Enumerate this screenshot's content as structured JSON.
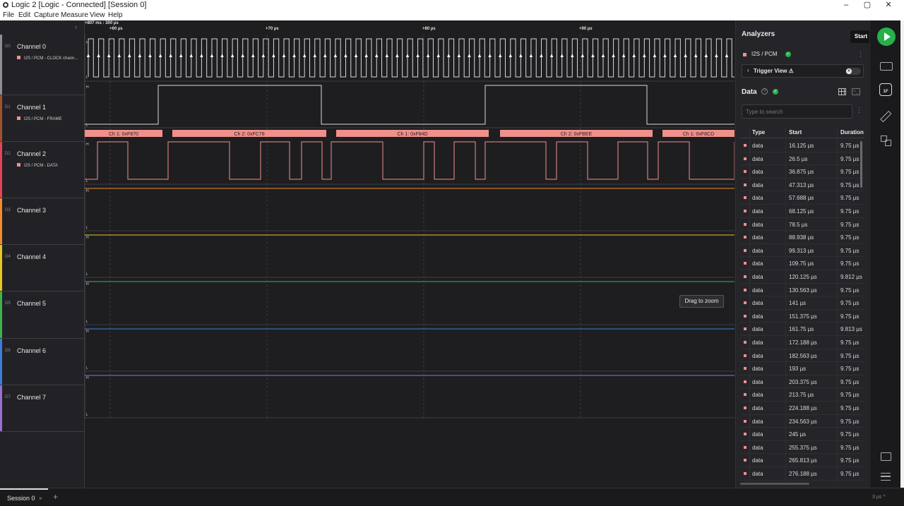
{
  "window": {
    "title": "Logic 2 [Logic - Connected] [Session 0]",
    "minimize": "–",
    "maximize": "▢",
    "close": "✕"
  },
  "menu": [
    "File",
    "Edit",
    "Capture",
    "Measure",
    "View",
    "Help"
  ],
  "ruler": {
    "cursor_label": "+807 ms : 300 µs",
    "ticks": [
      "+60 µs",
      "+70 µs",
      "+80 µs",
      "+90 µs"
    ]
  },
  "channels": [
    {
      "num": "D0",
      "name": "Channel 0",
      "sub": "I2S / PCM - CLOCK chann...",
      "color": "#8e8e93"
    },
    {
      "num": "D1",
      "name": "Channel 1",
      "sub": "I2S / PCM - FRAME",
      "color": "#a0522d"
    },
    {
      "num": "D2",
      "name": "Channel 2",
      "sub": "I2S / PCM - DATA",
      "color": "#e0455a"
    },
    {
      "num": "D3",
      "name": "Channel 3",
      "sub": "",
      "color": "#f08c2a"
    },
    {
      "num": "D4",
      "name": "Channel 4",
      "sub": "",
      "color": "#e9c723"
    },
    {
      "num": "D5",
      "name": "Channel 5",
      "sub": "",
      "color": "#3cb44b"
    },
    {
      "num": "D6",
      "name": "Channel 6",
      "sub": "",
      "color": "#3d7fd6"
    },
    {
      "num": "D7",
      "name": "Channel 7",
      "sub": "",
      "color": "#9b6fd6"
    }
  ],
  "level_labels": {
    "high": "H",
    "low": "L"
  },
  "decoded_frames": [
    "Ch 1: 0xF870",
    "Ch 2: 0xFC76",
    "Ch 1: 0xF84D",
    "Ch 2: 0xFBEE",
    "Ch 1: 0xF8CD"
  ],
  "tooltip": "Drag to zoom",
  "panel": {
    "analyzers_title": "Analyzers",
    "start_label": "Start",
    "analyzer_name": "I2S / PCM",
    "trigger_view": "Trigger View ⚠",
    "data_title": "Data",
    "search_placeholder": "Type to search",
    "columns": [
      "Type",
      "Start",
      "Duration"
    ],
    "rows": [
      [
        "data",
        "16.125 µs",
        "9.75 µs"
      ],
      [
        "data",
        "26.5 µs",
        "9.75 µs"
      ],
      [
        "data",
        "36.875 µs",
        "9.75 µs"
      ],
      [
        "data",
        "47.313 µs",
        "9.75 µs"
      ],
      [
        "data",
        "57.688 µs",
        "9.75 µs"
      ],
      [
        "data",
        "68.125 µs",
        "9.75 µs"
      ],
      [
        "data",
        "78.5 µs",
        "9.75 µs"
      ],
      [
        "data",
        "88.938 µs",
        "9.75 µs"
      ],
      [
        "data",
        "99.313 µs",
        "9.75 µs"
      ],
      [
        "data",
        "109.75 µs",
        "9.75 µs"
      ],
      [
        "data",
        "120.125 µs",
        "9.812 µs"
      ],
      [
        "data",
        "130.563 µs",
        "9.75 µs"
      ],
      [
        "data",
        "141 µs",
        "9.75 µs"
      ],
      [
        "data",
        "151.375 µs",
        "9.75 µs"
      ],
      [
        "data",
        "161.75 µs",
        "9.813 µs"
      ],
      [
        "data",
        "172.188 µs",
        "9.75 µs"
      ],
      [
        "data",
        "182.563 µs",
        "9.75 µs"
      ],
      [
        "data",
        "193 µs",
        "9.75 µs"
      ],
      [
        "data",
        "203.375 µs",
        "9.75 µs"
      ],
      [
        "data",
        "213.75 µs",
        "9.75 µs"
      ],
      [
        "data",
        "224.188 µs",
        "9.75 µs"
      ],
      [
        "data",
        "234.563 µs",
        "9.75 µs"
      ],
      [
        "data",
        "245 µs",
        "9.75 µs"
      ],
      [
        "data",
        "255.375 µs",
        "9.75 µs"
      ],
      [
        "data",
        "265.813 µs",
        "9.75 µs"
      ],
      [
        "data",
        "276.188 µs",
        "9.75 µs"
      ]
    ]
  },
  "iconbar": {
    "analyzer_badge": "1F"
  },
  "bottom": {
    "session_tab": "Session 0",
    "close": "×",
    "add": "+",
    "zoom_readout": "3 µs ^"
  },
  "colors": {
    "accent": "#27b04a",
    "analyzer_swatch": "#f0908a",
    "decode_bar": "#f0908a"
  }
}
